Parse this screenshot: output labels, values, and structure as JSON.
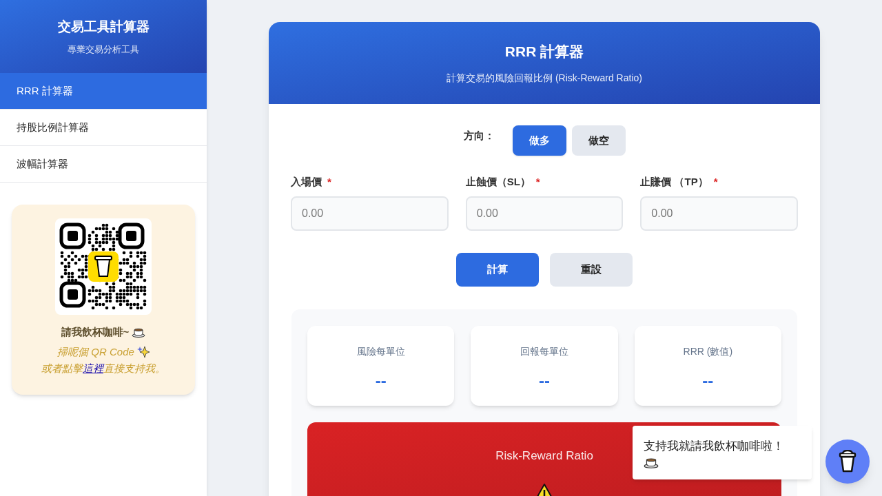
{
  "sidebar": {
    "title": "交易工具計算器",
    "subtitle": "專業交易分析工具",
    "items": [
      {
        "label": "RRR 計算器",
        "selected": true
      },
      {
        "label": "持股比例計算器",
        "selected": false
      },
      {
        "label": "波幅計算器",
        "selected": false
      }
    ],
    "support_card": {
      "heading": "請我飲杯咖啡~",
      "line_1": "掃呢個 QR Code",
      "line_2_before": "或者點擊",
      "link": "這裡",
      "line_2_after": "直接支持我。"
    }
  },
  "calculator": {
    "title": "RRR 計算器",
    "subtitle": "計算交易的風險回報比例 (Risk-Reward Ratio)",
    "direction_label": "方向：",
    "directions": [
      {
        "label": "做多",
        "selected": true
      },
      {
        "label": "做空",
        "selected": false
      }
    ],
    "fields": [
      {
        "label": "入場價",
        "required_mark": "*",
        "placeholder": "0.00"
      },
      {
        "label": "止蝕價（SL）",
        "required_mark": "*",
        "placeholder": "0.00"
      },
      {
        "label": "止賺價 （TP）",
        "required_mark": "*",
        "placeholder": "0.00"
      }
    ],
    "buttons": [
      {
        "label": "計算",
        "kind": "primary"
      },
      {
        "label": "重設",
        "kind": "secondary"
      }
    ],
    "results": [
      {
        "label": "風險每單位",
        "value": "--"
      },
      {
        "label": "回報每單位",
        "value": "--"
      },
      {
        "label": "RRR (數值)",
        "value": "--"
      }
    ],
    "ratio_banner": {
      "title": "Risk-Reward Ratio"
    }
  },
  "support_popup": {
    "message": "支持我就請我飲杯咖啡啦！"
  }
}
